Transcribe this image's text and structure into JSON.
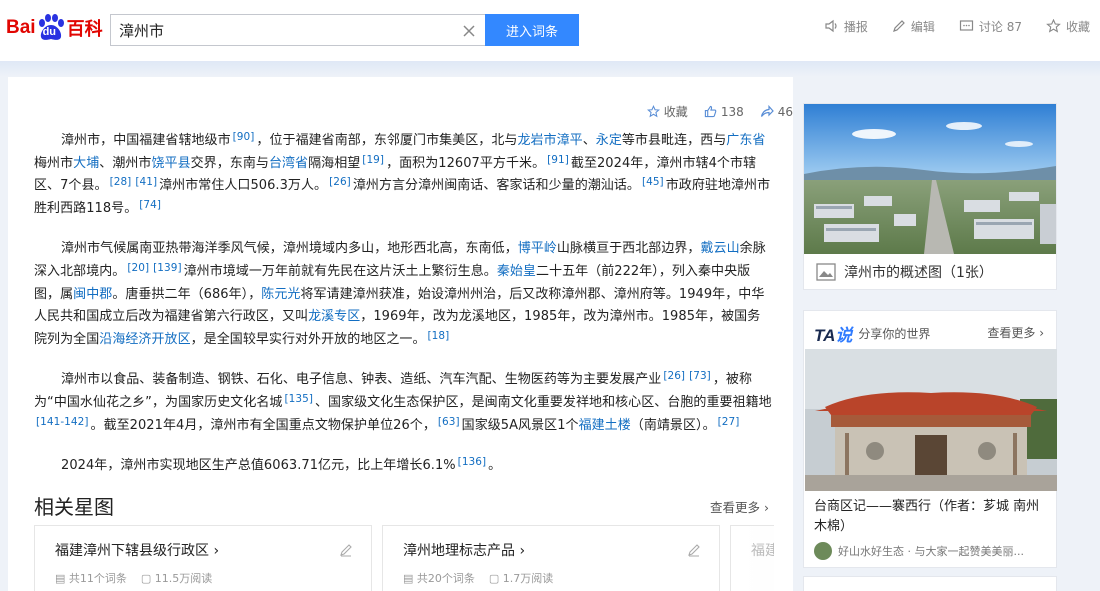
{
  "header": {
    "logo_bai": "Bai",
    "logo_du": "du",
    "logo_baike": "百科",
    "search_value": "漳州市",
    "search_button": "进入词条",
    "actions": [
      {
        "icon": "speaker-icon",
        "label": "播报"
      },
      {
        "icon": "pencil-icon",
        "label": "编辑"
      },
      {
        "icon": "comment-icon",
        "label": "讨论 87"
      },
      {
        "icon": "star-icon",
        "label": "收藏"
      }
    ]
  },
  "stats": {
    "collect": "收藏",
    "likes": "138",
    "shares": "46"
  },
  "article": {
    "p1": {
      "t1": "漳州市，中国福建省辖地级市",
      "r1": "[90]",
      "t2": "，位于福建省南部，东邻厦门市集美区，北与",
      "l1": "龙岩市漳平",
      "t3": "、",
      "l2": "永定",
      "t4": "等市县毗连，西与",
      "l3": "广东省",
      "t5": "梅州市",
      "l4": "大埔",
      "t6": "、潮州市",
      "l5": "饶平县",
      "t7": "交界，东南与",
      "l6": "台湾省",
      "t8": "隔海相望",
      "r2": "[19]",
      "t9": "，面积为12607平方千米。",
      "r3": "[91]",
      "t10": "截至2024年，漳州市辖4个市辖区、7个县。",
      "r4": "[28]",
      "r5": "[41]",
      "t11": "漳州市常住人口506.3万人。",
      "r6": "[26]",
      "t12": "漳州方言分漳州闽南话、客家话和少量的潮汕话。",
      "r7": "[45]",
      "t13": "市政府驻地漳州市胜利西路118号。",
      "r8": "[74]"
    },
    "p2": {
      "t1": "漳州市气候属南亚热带海洋季风气候，漳州境域内多山，地形西北高，东南低，",
      "l1": "博平岭",
      "t2": "山脉横亘于西北部边界，",
      "l2": "戴云山",
      "t3": "余脉深入北部境内。",
      "r1": "[20]",
      "r2": "[139]",
      "t4": "漳州市境域一万年前就有先民在这片沃土上繁衍生息。",
      "l3": "秦始皇",
      "t5": "二十五年（前222年），列入秦中央版图，属",
      "l4": "闽中郡",
      "t6": "。唐垂拱二年（686年），",
      "l5": "陈元光",
      "t7": "将军请建漳州获准，始设漳州州治，后又改称漳州郡、漳州府等。1949年，中华人民共和国成立后改为福建省第六行政区，又叫",
      "l6": "龙溪专区",
      "t8": "，1969年，改为龙溪地区，1985年，改为漳州市。1985年，被国务院列为全国",
      "l7": "沿海经济开放区",
      "t9": "，是全国较早实行对外开放的地区之一。",
      "r3": "[18]"
    },
    "p3": {
      "t1": "漳州市以食品、装备制造、钢铁、石化、电子信息、钟表、造纸、汽车汽配、生物医药等为主要发展产业",
      "r1": "[26]",
      "r2": "[73]",
      "t2": "，被称为“中国水仙花之乡”，为国家历史文化名城",
      "r3": "[135]",
      "t3": "、国家级文化生态保护区，是闽南文化重要发祥地和核心区、台胞的重要祖籍地",
      "r4": "[141-142]",
      "t4": "。截至2021年4月，漳州市有全国重点文物保护单位26个，",
      "r5": "[63]",
      "t5": "国家级5A风景区1个",
      "l1": "福建土楼",
      "t6": "（南靖景区）。",
      "r6": "[27]"
    },
    "p4": {
      "t1": "2024年，漳州市实现地区生产总值6063.71亿元，比上年增长6.1%",
      "r1": "[136]",
      "t2": "。"
    }
  },
  "related": {
    "title": "相关星图",
    "more": "查看更多",
    "cards": [
      {
        "title": "福建漳州下辖县级行政区",
        "count": "共11个词条",
        "views": "11.5万阅读"
      },
      {
        "title": "漳州地理标志产品",
        "count": "共20个词条",
        "views": "1.7万阅读"
      },
      {
        "title": "福建",
        "count": "",
        "views": ""
      }
    ]
  },
  "sidebar": {
    "image_caption": "漳州市的概述图（1张）",
    "ta_logo_ta": "TA",
    "ta_logo_shuo": "说",
    "ta_slogan": "分享你的世界",
    "ta_more": "查看更多",
    "ta_title": "台商区记——褰西行（作者：芗城 南州木棉）",
    "ta_author": "好山水好生态 · 与大家一起赞美美丽..."
  },
  "colors": {
    "link": "#136ec2",
    "brand_red": "#e10602",
    "brand_blue": "#2932e1",
    "button_blue": "#3388ff"
  }
}
